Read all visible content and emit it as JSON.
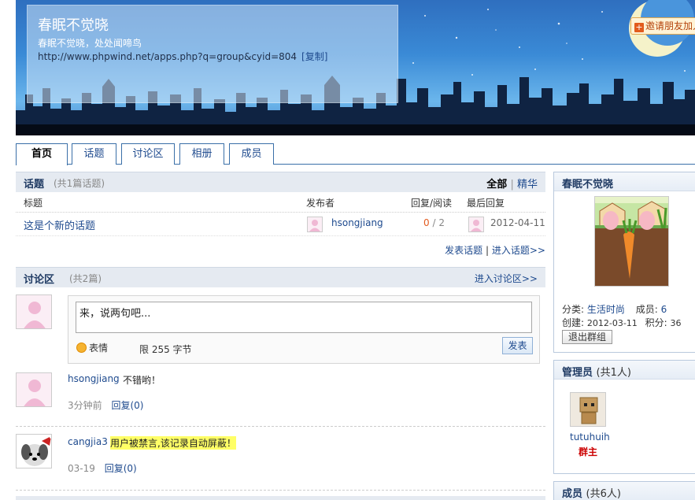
{
  "group": {
    "name": "春眠不觉晓",
    "description": "春眠不觉晓，处处闻啼鸟",
    "url": "http://www.phpwind.net/apps.php?q=group&cyid=804",
    "copy_label": "[复制]",
    "invite_label": "邀请朋友加入"
  },
  "tabs": [
    {
      "label": "首页",
      "active": true
    },
    {
      "label": "话题",
      "active": false
    },
    {
      "label": "讨论区",
      "active": false
    },
    {
      "label": "相册",
      "active": false
    },
    {
      "label": "成员",
      "active": false
    }
  ],
  "topics": {
    "title": "话题",
    "count": "(共1篇话题)",
    "filter_all": "全部",
    "filter_sep": "|",
    "filter_digest": "精华",
    "columns": [
      "标题",
      "发布者",
      "回复/阅读",
      "最后回复"
    ],
    "rows": [
      {
        "title": "这是个新的话题",
        "author": "hsongjiang",
        "replies": "0",
        "views": "/ 2",
        "last_reply": "2012-04-11"
      }
    ],
    "post_link": "发表话题",
    "link_sep": "|",
    "enter_link": "进入话题>>"
  },
  "discussion": {
    "title": "讨论区",
    "count": "(共2篇)",
    "enter_link": "进入讨论区>>",
    "composer_text": "来，说两句吧...",
    "emoji_label": "表情",
    "limit_label": "限 255 字节",
    "send_label": "发表",
    "posts": [
      {
        "user": "hsongjiang",
        "text": "不错哟！",
        "time": "3分钟前",
        "reply": "回复(0)"
      },
      {
        "user": "cangjia3",
        "text": "用户被禁言,该记录自动屏蔽！",
        "time": "03-19",
        "reply": "回复(0)"
      }
    ]
  },
  "sidebar": {
    "group_title": "春眠不觉晓",
    "category_label": "分类:",
    "category_value": "生活时尚",
    "members_label": "成员:",
    "members_value": "6",
    "created_label": "创建:",
    "created_value": "2012-03-11",
    "points_label": "积分:",
    "points_value": "36",
    "quit_label": "退出群组",
    "admins_title": "管理员",
    "admins_count": "(共1人)",
    "admin_name": "tutuhuih",
    "admin_role": "群主",
    "members_title": "成员",
    "members_count": "(共6人)"
  },
  "colors": {
    "link": "#1e4a8e",
    "accent_orange": "#e35b1f",
    "banned_highlight": "#ffff66",
    "role_red": "#cc0000"
  }
}
